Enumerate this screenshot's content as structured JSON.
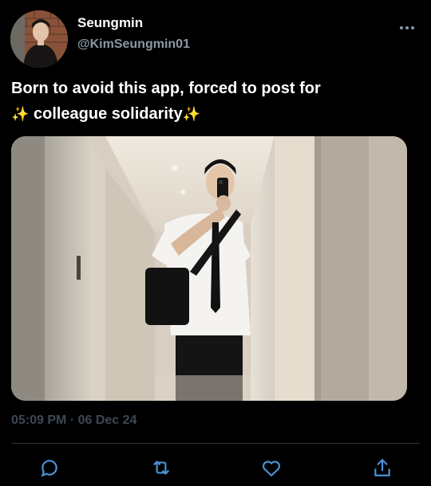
{
  "author": {
    "display_name": "Seungmin",
    "handle": "@KimSeungmin01"
  },
  "tweet": {
    "line1": "Born to avoid this app, forced to post for",
    "sparkle": "✨",
    "line2": " colleague solidarity"
  },
  "meta": {
    "timestamp": "05:09 PM · 06 Dec 24"
  },
  "icons": {
    "more": "more-horizontal-icon",
    "reply": "reply-icon",
    "retweet": "retweet-icon",
    "like": "like-icon",
    "share": "share-icon"
  },
  "colors": {
    "background": "#000000",
    "text": "#ffffff",
    "secondary": "#8b98a5",
    "timestamp": "#3d4854",
    "icon": "#4a93d6",
    "sparkle": "#ffd54a"
  }
}
